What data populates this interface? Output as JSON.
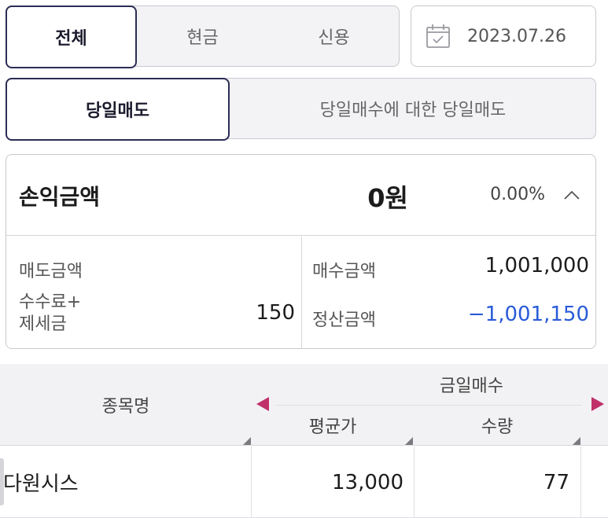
{
  "account_tabs": [
    {
      "label": "전체",
      "active": true
    },
    {
      "label": "현금",
      "active": false
    },
    {
      "label": "신용",
      "active": false
    }
  ],
  "date": {
    "value": "2023.07.26",
    "icon": "calendar-icon"
  },
  "sell_tabs": [
    {
      "label": "당일매도",
      "active": true
    },
    {
      "label": "당일매수에 대한 당일매도",
      "active": false
    }
  ],
  "summary": {
    "pl_label": "손익금액",
    "pl_amount": "0원",
    "pl_rate": "0.00%",
    "sell_amount_label": "매도금액",
    "sell_amount_value": "",
    "fee_label_line1": "수수료+",
    "fee_label_line2": "제세금",
    "fee_value": "150",
    "buy_amount_label": "매수금액",
    "buy_amount_value": "1,001,000",
    "settlement_label": "정산금액",
    "settlement_value": "−1,001,150"
  },
  "table": {
    "name_header": "종목명",
    "group_header": "금일매수",
    "columns": [
      "평균가",
      "수량"
    ],
    "rows": [
      {
        "name": "다원시스",
        "avg_price": "13,000",
        "quantity": "77"
      }
    ]
  },
  "colors": {
    "accent": "#2c2d55",
    "negative": "#2a5bd7",
    "scroll_arrow": "#c0316a"
  }
}
